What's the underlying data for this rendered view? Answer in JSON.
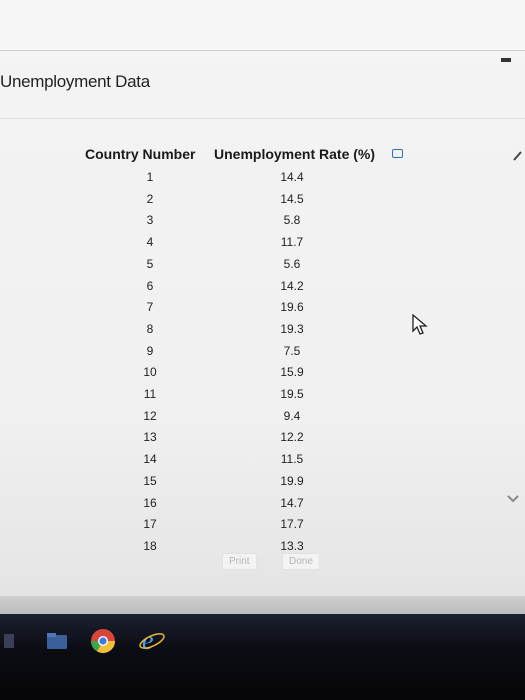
{
  "window": {
    "title": "Unemployment Data"
  },
  "table": {
    "headers": {
      "country_number": "Country Number",
      "unemployment_rate": "Unemployment Rate (%)"
    },
    "rows": [
      {
        "country": "1",
        "rate": "14.4"
      },
      {
        "country": "2",
        "rate": "14.5"
      },
      {
        "country": "3",
        "rate": "5.8"
      },
      {
        "country": "4",
        "rate": "11.7"
      },
      {
        "country": "5",
        "rate": "5.6"
      },
      {
        "country": "6",
        "rate": "14.2"
      },
      {
        "country": "7",
        "rate": "19.6"
      },
      {
        "country": "8",
        "rate": "19.3"
      },
      {
        "country": "9",
        "rate": "7.5"
      },
      {
        "country": "10",
        "rate": "15.9"
      },
      {
        "country": "11",
        "rate": "19.5"
      },
      {
        "country": "12",
        "rate": "9.4"
      },
      {
        "country": "13",
        "rate": "12.2"
      },
      {
        "country": "14",
        "rate": "11.5"
      },
      {
        "country": "15",
        "rate": "19.9"
      },
      {
        "country": "16",
        "rate": "14.7"
      },
      {
        "country": "17",
        "rate": "17.7"
      },
      {
        "country": "18",
        "rate": "13.3"
      }
    ]
  },
  "buttons": {
    "print": "Print",
    "done": "Done"
  },
  "icons": {
    "copy": "copy-icon",
    "minimize": "minimize-icon",
    "cursor": "mouse-pointer-icon"
  },
  "colors": {
    "accent": "#2f6fb8"
  }
}
